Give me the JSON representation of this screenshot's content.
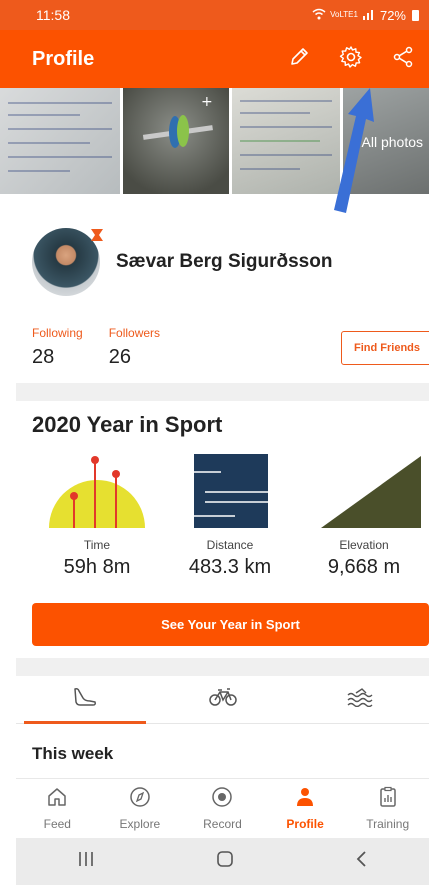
{
  "status_bar": {
    "time": "11:58",
    "network": "VoLTE1",
    "battery": "72%"
  },
  "app_bar": {
    "title": "Profile",
    "icons": [
      "edit-icon",
      "gear-icon",
      "share-icon"
    ]
  },
  "photos": {
    "all_photos_label": "All photos"
  },
  "athlete": {
    "name": "Sævar Berg Sigurðsson"
  },
  "follow": {
    "following_label": "Following",
    "following_count": "28",
    "followers_label": "Followers",
    "followers_count": "26",
    "find_friends_label": "Find Friends"
  },
  "year_in_sport": {
    "title": "2020 Year in Sport",
    "stats": [
      {
        "label": "Time",
        "value": "59h 8m"
      },
      {
        "label": "Distance",
        "value": "483.3 km"
      },
      {
        "label": "Elevation",
        "value": "9,668 m"
      }
    ],
    "button_label": "See Your Year in Sport"
  },
  "activity_tabs": {
    "active": "run",
    "items": [
      "run-icon",
      "bike-icon",
      "swim-icon"
    ]
  },
  "this_week": {
    "title": "This week"
  },
  "bottom_nav": {
    "items": [
      {
        "label": "Feed",
        "icon": "home-icon"
      },
      {
        "label": "Explore",
        "icon": "compass-icon"
      },
      {
        "label": "Record",
        "icon": "record-icon"
      },
      {
        "label": "Profile",
        "icon": "person-icon",
        "active": true
      },
      {
        "label": "Training",
        "icon": "clipboard-icon"
      }
    ]
  },
  "system_nav": {
    "items": [
      "recent-apps-icon",
      "home-button-icon",
      "back-icon"
    ]
  },
  "colors": {
    "brand": "#fc5200",
    "status_bar": "#ee5a1c",
    "annotation_arrow": "#3a6fd6"
  }
}
